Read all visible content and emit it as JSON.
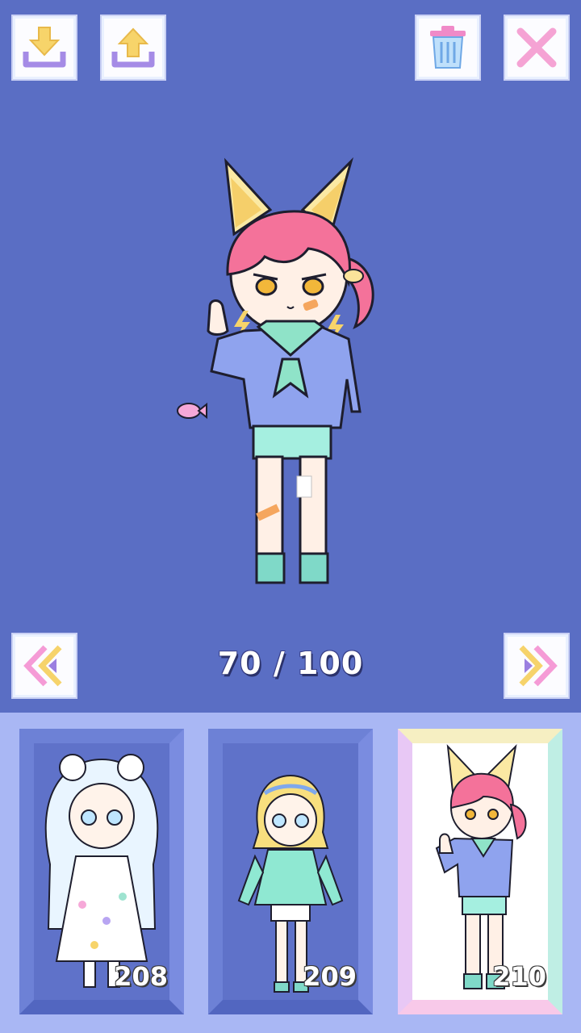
{
  "toolbar": {
    "download_icon": "download-icon",
    "upload_icon": "upload-icon",
    "trash_icon": "trash-icon",
    "close_icon": "close-icon"
  },
  "preview": {
    "counter_current": "70",
    "counter_total": "100",
    "counter_text": "70 / 100"
  },
  "navigation": {
    "prev_icon": "double-chevron-left-icon",
    "next_icon": "double-chevron-right-icon"
  },
  "slots": [
    {
      "number": "208",
      "selected": false
    },
    {
      "number": "209",
      "selected": false
    },
    {
      "number": "210",
      "selected": true
    }
  ],
  "colors": {
    "background": "#5a6ec4",
    "tray": "#a9b7f4",
    "accent_pink": "#f59bd6",
    "accent_purple": "#9b7fe0",
    "accent_yellow": "#f6d36b"
  }
}
